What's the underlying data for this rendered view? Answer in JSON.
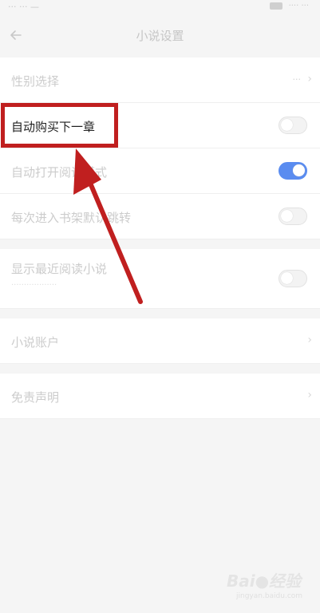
{
  "status_bar": {
    "carrier": "··· ··· —",
    "right_info": "···· ···"
  },
  "header": {
    "back_icon": "back-arrow-icon",
    "title": "小说设置"
  },
  "settings": [
    {
      "label": "性别选择",
      "value": "···",
      "type": "nav"
    },
    {
      "label": "自动购买下一章",
      "type": "toggle",
      "on": false
    },
    {
      "label": "自动打开阅读模式",
      "type": "toggle",
      "on": true
    },
    {
      "label": "每次进入书架默认跳转",
      "type": "toggle",
      "on": false
    },
    {
      "label": "显示最近阅读小说",
      "sublabel": "··················",
      "type": "toggle",
      "on": false
    },
    {
      "label": "小说账户",
      "type": "nav"
    },
    {
      "label": "免责声明",
      "type": "nav"
    }
  ],
  "annotation": {
    "color": "#c01f1f"
  },
  "watermark": {
    "brand": "Bai●经验",
    "url": "jingyan.baidu.com"
  },
  "colors": {
    "toggle_on": "#5a8cf0",
    "background": "#f5f5f5"
  }
}
